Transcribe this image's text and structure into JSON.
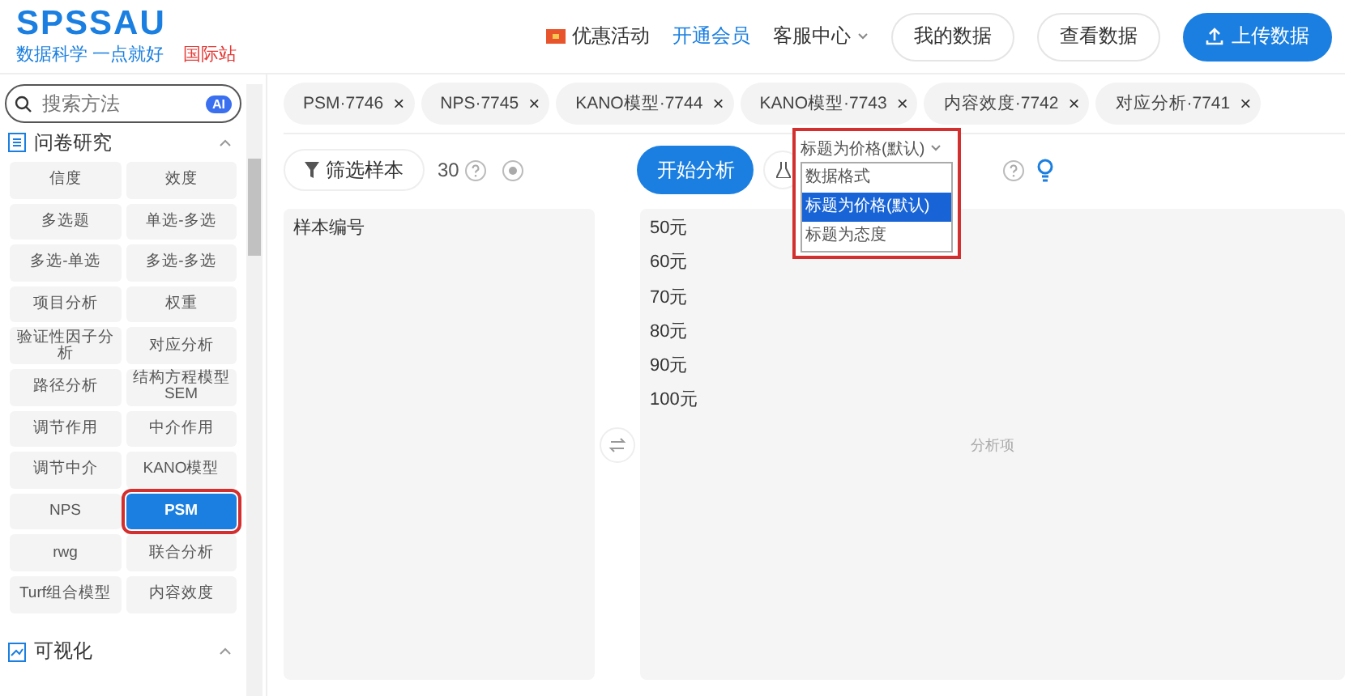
{
  "logo": {
    "title": "SPSSAU",
    "slogan": "数据科学 一点就好",
    "site": "国际站"
  },
  "header": {
    "links": [
      {
        "label": "优惠活动",
        "kind": "promo"
      },
      {
        "label": "开通会员",
        "kind": "member"
      },
      {
        "label": "客服中心",
        "kind": "menu"
      }
    ],
    "buttons": [
      {
        "label": "我的数据",
        "kind": "plain"
      },
      {
        "label": "查看数据",
        "kind": "plain"
      },
      {
        "label": "上传数据",
        "kind": "primary"
      }
    ]
  },
  "sidebar": {
    "search": {
      "placeholder": "搜索方法",
      "badge": "AI"
    },
    "sections": [
      {
        "title": "问卷研究",
        "expanded": true,
        "items": [
          {
            "label": "信度",
            "selected": false,
            "annotated": false
          },
          {
            "label": "效度",
            "selected": false,
            "annotated": false
          },
          {
            "label": "多选题",
            "selected": false,
            "annotated": false
          },
          {
            "label": "单选-多选",
            "selected": false,
            "annotated": false
          },
          {
            "label": "多选-单选",
            "selected": false,
            "annotated": false
          },
          {
            "label": "多选-多选",
            "selected": false,
            "annotated": false
          },
          {
            "label": "项目分析",
            "selected": false,
            "annotated": false
          },
          {
            "label": "权重",
            "selected": false,
            "annotated": false
          },
          {
            "label": "验证性因子分析",
            "selected": false,
            "annotated": false
          },
          {
            "label": "对应分析",
            "selected": false,
            "annotated": false
          },
          {
            "label": "路径分析",
            "selected": false,
            "annotated": false
          },
          {
            "label": "结构方程模型SEM",
            "selected": false,
            "annotated": false
          },
          {
            "label": "调节作用",
            "selected": false,
            "annotated": false
          },
          {
            "label": "中介作用",
            "selected": false,
            "annotated": false
          },
          {
            "label": "调节中介",
            "selected": false,
            "annotated": false
          },
          {
            "label": "KANO模型",
            "selected": false,
            "annotated": false
          },
          {
            "label": "NPS",
            "selected": false,
            "annotated": false
          },
          {
            "label": "PSM",
            "selected": true,
            "annotated": true
          },
          {
            "label": "rwg",
            "selected": false,
            "annotated": false
          },
          {
            "label": "联合分析",
            "selected": false,
            "annotated": false
          },
          {
            "label": "Turf组合模型",
            "selected": false,
            "annotated": false
          },
          {
            "label": "内容效度",
            "selected": false,
            "annotated": false
          }
        ]
      },
      {
        "title": "可视化",
        "expanded": true
      }
    ]
  },
  "tabs": [
    {
      "label": "PSM·7746",
      "close": "×"
    },
    {
      "label": "NPS·7745",
      "close": "×"
    },
    {
      "label": "KANO模型·7744",
      "close": "×"
    },
    {
      "label": "KANO模型·7743",
      "close": "×"
    },
    {
      "label": "内容效度·7742",
      "close": "×"
    },
    {
      "label": "对应分析·7741",
      "close": "×"
    }
  ],
  "toolbar": {
    "filter": "筛选样本",
    "count": "30",
    "start": "开始分析",
    "dropdown": {
      "value": "标题为价格(默认)",
      "annotated": true,
      "open": true,
      "options": [
        {
          "label": "数据格式",
          "selected": false
        },
        {
          "label": "标题为价格(默认)",
          "selected": true
        },
        {
          "label": "标题为态度",
          "selected": false
        }
      ]
    }
  },
  "left_panel": {
    "items": [
      "样本编号"
    ]
  },
  "right_panel": {
    "items": [
      "50元",
      "60元",
      "70元",
      "80元",
      "90元",
      "100元"
    ],
    "hint": "分析项"
  }
}
